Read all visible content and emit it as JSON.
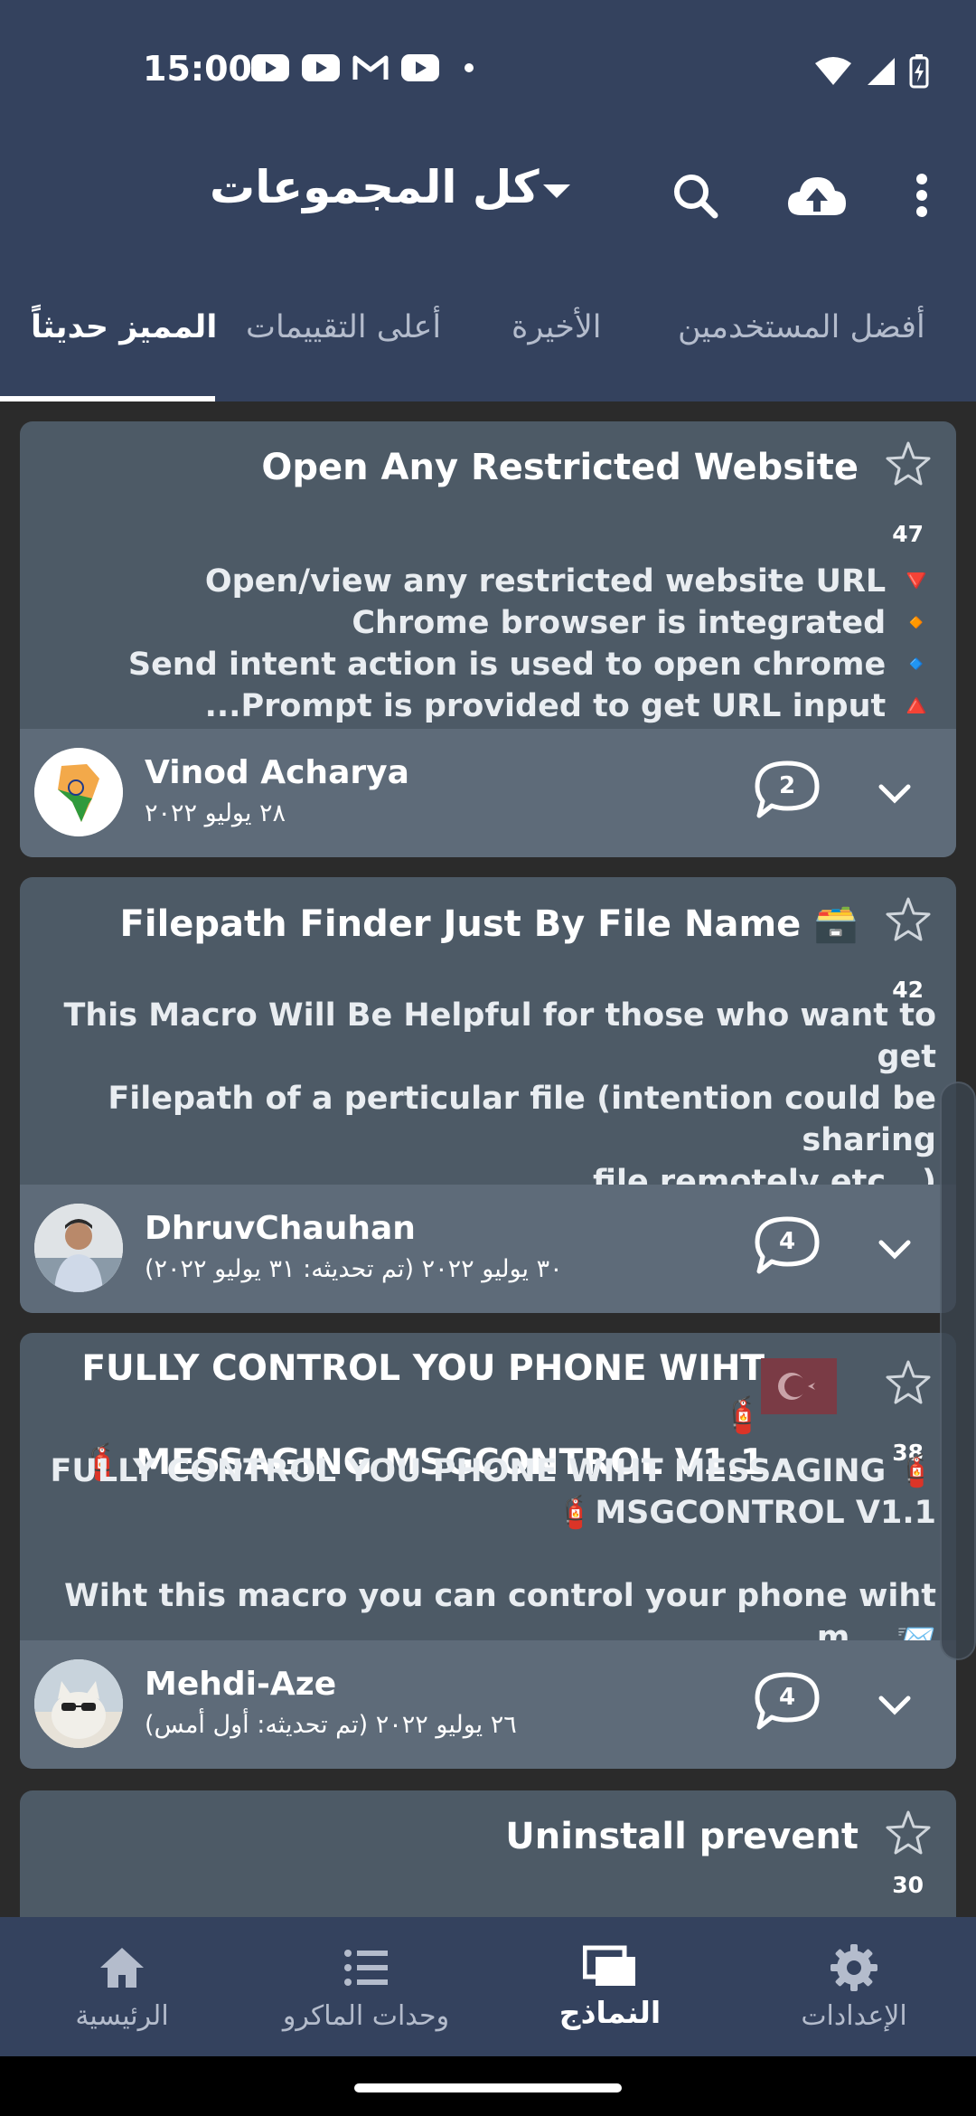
{
  "status_bar": {
    "time": "15:00",
    "icons": [
      "youtube-icon",
      "youtube-icon",
      "gmail-icon",
      "youtube-icon",
      "dot-icon",
      "wifi-icon",
      "signal-icon",
      "battery-charging-icon"
    ]
  },
  "app_bar": {
    "title": "كل المجموعات",
    "icons": [
      "dropdown-icon",
      "search-icon",
      "cloud-upload-icon",
      "more-vert-icon"
    ]
  },
  "tabs": [
    {
      "label": "المميز حديثاً",
      "active": true
    },
    {
      "label": "أعلى التقييمات",
      "active": false
    },
    {
      "label": "الأخيرة",
      "active": false
    },
    {
      "label": "أفضل المستخدمين",
      "active": false
    }
  ],
  "cards": [
    {
      "title": "Open Any Restricted Website",
      "stars": "47",
      "description": [
        "Open/view any  restricted website URL 🔻",
        "Chrome browser is integrated 🔸",
        "Send intent action is used to open chrome 🔹",
        "...Prompt is provided to get URL input 🔺"
      ],
      "author": "Vinod Acharya",
      "date": "٢٨ يوليو ٢٠٢٢",
      "comments": "2"
    },
    {
      "title": "Filepath Finder Just By File Name 🗃️",
      "stars": "42",
      "description": [
        "This Macro Will Be Helpful for those who want to get",
        "Filepath of a perticular file (intention could be sharing",
        "file remotely etc...)"
      ],
      "author": "DhruvChauhan",
      "date": "٣٠ يوليو ٢٠٢٢ (تم تحديثه: ٣١ يوليو ٢٠٢٢)",
      "comments": "4"
    },
    {
      "title_lines": [
        "FULLY CONTROL YOU PHONE WIHT 🧯",
        "🧯 MESSAGING MSGCONTROL V1.1"
      ],
      "stars": "38",
      "description": [
        "FULLY CONTROL YOU PHONE WIHT MESSAGING 🧯",
        "🧯MSGCONTROL V1.1",
        "",
        "Wiht this macro you can control your phone wiht m... 📨"
      ],
      "author": "Mehdi-Aze",
      "date": "٢٦ يوليو ٢٠٢٢ (تم تحديثه: أول أمس)",
      "comments": "4"
    },
    {
      "title": "Uninstall prevent",
      "stars": "30"
    }
  ],
  "bottom_nav": [
    {
      "label": "الرئيسية",
      "icon": "home-icon",
      "active": false
    },
    {
      "label": "وحدات الماكرو",
      "icon": "list-icon",
      "active": false
    },
    {
      "label": "النماذج",
      "icon": "templates-icon",
      "active": true
    },
    {
      "label": "الإعدادات",
      "icon": "gear-icon",
      "active": false
    }
  ],
  "colors": {
    "header": "#34425e",
    "card": "#4d5a66",
    "card_footer": "#5e6b79",
    "background": "#2b2b2b"
  }
}
